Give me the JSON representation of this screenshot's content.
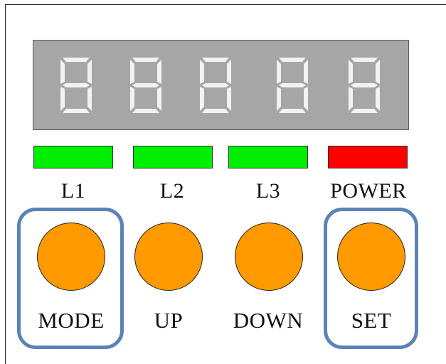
{
  "colors": {
    "display_bg": "#a6a6a6",
    "segment": "#f2f2f2",
    "led_on_green": "#00ee00",
    "led_power_red": "#ff0000",
    "button_orange": "#ff9900",
    "highlight_blue": "#5b83b7"
  },
  "display": {
    "digits": [
      "8",
      "8",
      "8",
      "8",
      "8"
    ]
  },
  "indicators": [
    {
      "label": "L1",
      "color": "#00ee00"
    },
    {
      "label": "L2",
      "color": "#00ee00"
    },
    {
      "label": "L3",
      "color": "#00ee00"
    },
    {
      "label": "POWER",
      "color": "#ff0000"
    }
  ],
  "buttons": [
    {
      "label": "MODE",
      "highlighted": true
    },
    {
      "label": "UP",
      "highlighted": false
    },
    {
      "label": "DOWN",
      "highlighted": false
    },
    {
      "label": "SET",
      "highlighted": true
    }
  ]
}
